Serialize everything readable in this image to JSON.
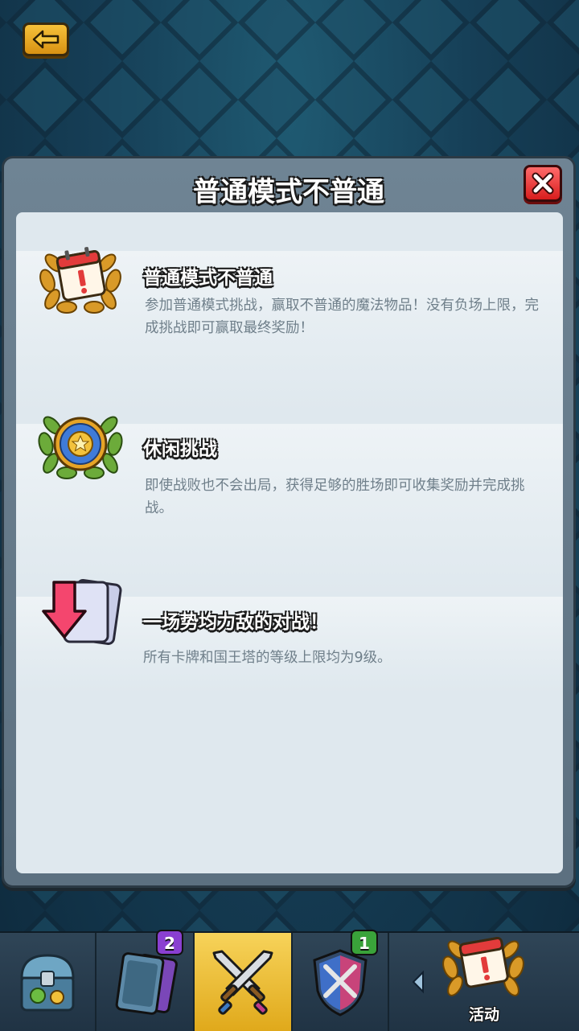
{
  "modal": {
    "title": "普通模式不普通"
  },
  "rules": [
    {
      "icon": "laurel-calendar-icon",
      "heading": "普通模式不普通",
      "description": "参加普通模式挑战，赢取不普通的魔法物品！没有负场上限，完成挑战即可赢取最终奖励！"
    },
    {
      "icon": "laurel-star-medal-icon",
      "heading": "休闲挑战",
      "description": "即使战败也不会出局，获得足够的胜场即可收集奖励并完成挑战。"
    },
    {
      "icon": "card-level-down-icon",
      "heading": "一场势均力敌的对战！",
      "description": "所有卡牌和国王塔的等级上限均为9级。"
    }
  ],
  "tabbar": {
    "tabs": [
      {
        "icon": "treasure-chest-icon",
        "badge": ""
      },
      {
        "icon": "cards-icon",
        "badge": "2"
      },
      {
        "icon": "crossed-swords-icon",
        "badge": ""
      },
      {
        "icon": "shield-swords-icon",
        "badge": "1"
      },
      {
        "icon": "laurel-calendar-icon",
        "label": "活动"
      }
    ]
  },
  "colors": {
    "accent_gold": "#f2c136",
    "close_red": "#e0262a",
    "badge_purple": "#8a3fd1",
    "badge_green": "#3aa33a"
  }
}
